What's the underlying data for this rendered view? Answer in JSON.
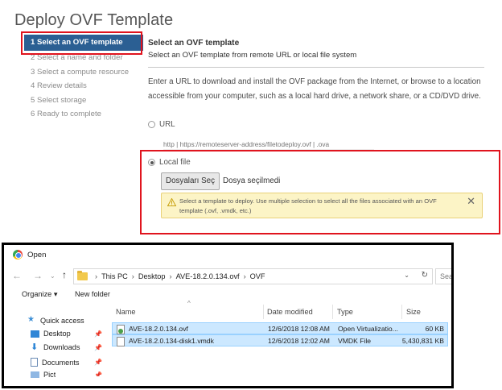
{
  "wizard": {
    "title": "Deploy OVF Template",
    "steps": [
      "1 Select an OVF template",
      "2 Select a name and folder",
      "3 Select a compute resource",
      "4 Review details",
      "5 Select storage",
      "6 Ready to complete"
    ],
    "active_step": 0,
    "panel_title": "Select an OVF template",
    "panel_subtitle": "Select an OVF template from remote URL or local file system",
    "intro_text": "Enter a URL to download and install the OVF package from the Internet, or browse to a location accessible from your computer, such as a local hard drive, a network share, or a CD/DVD drive.",
    "url_option_label": "URL",
    "url_placeholder": "http | https://remoteserver-address/filetodeploy.ovf | .ova",
    "local_file_label": "Local file",
    "selected_option": "Local file",
    "file_button_label": "Dosyaları Seç",
    "no_file_text": "Dosya seçilmedi",
    "warning_text": "Select a template to deploy. Use multiple selection to select all the files associated with an OVF template (.ovf, .vmdk, etc.)",
    "warning_close": "✕",
    "accent_color": "#2b5f93",
    "highlight_color": "#e0141e",
    "warning_bg": "#fcf4c6"
  },
  "open_dialog": {
    "title": "Open",
    "breadcrumb": [
      "This PC",
      "Desktop",
      "AVE-18.2.0.134.ovf",
      "OVF"
    ],
    "search_placeholder": "Sea",
    "toolbar": {
      "organize": "Organize ▾",
      "new_folder": "New folder"
    },
    "nav_items": [
      {
        "label": "Quick access",
        "icon": "star-icon"
      },
      {
        "label": "Desktop",
        "icon": "desktop-icon"
      },
      {
        "label": "Downloads",
        "icon": "download-icon"
      },
      {
        "label": "Documents",
        "icon": "document-icon"
      },
      {
        "label": "Pict",
        "icon": "pictures-icon"
      }
    ],
    "columns": {
      "name": "Name",
      "date": "Date modified",
      "type": "Type",
      "size": "Size"
    },
    "files": [
      {
        "name": "AVE-18.2.0.134.ovf",
        "date": "12/6/2018 12:08 AM",
        "type": "Open Virtualizatio...",
        "size": "60 KB",
        "icon": "ovf-file-icon"
      },
      {
        "name": "AVE-18.2.0.134-disk1.vmdk",
        "date": "12/6/2018 12:02 AM",
        "type": "VMDK File",
        "size": "5,430,831 KB",
        "icon": "vmdk-file-icon"
      }
    ]
  }
}
